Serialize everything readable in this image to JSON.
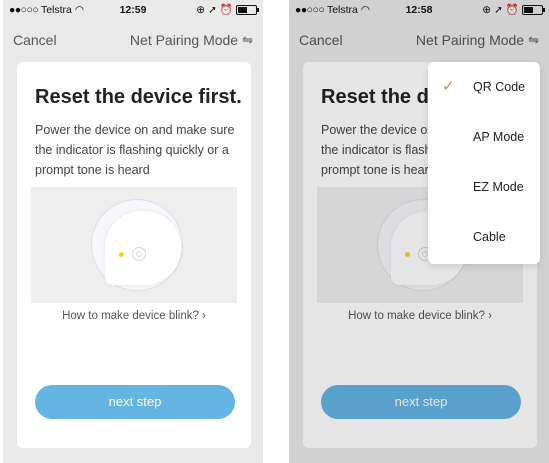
{
  "statusbar_left": {
    "carrier": "Telstra",
    "time": "12:59"
  },
  "statusbar_right": {
    "carrier": "Telstra",
    "time": "12:58"
  },
  "nav": {
    "cancel_label": "Cancel",
    "mode_label": "Net Pairing Mode"
  },
  "card": {
    "title": "Reset the device first.",
    "description": "Power the device on and make sure the indicator is flashing quickly or a prompt tone is heard",
    "link_label": "How to make device blink?",
    "next_label": "next step"
  },
  "menu": {
    "selected": "QR Code",
    "items": [
      {
        "label": "QR Code"
      },
      {
        "label": "AP Mode"
      },
      {
        "label": "EZ Mode"
      },
      {
        "label": "Cable"
      }
    ]
  },
  "colors": {
    "accent_blue": "#64b4e4",
    "check_orange": "#f07a3a",
    "led_yellow": "#ffd21a"
  }
}
